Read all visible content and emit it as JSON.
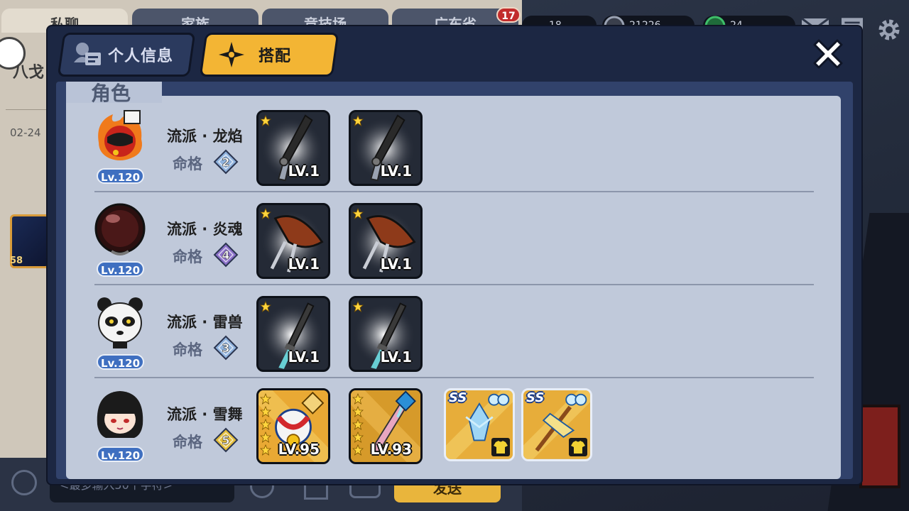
{
  "background": {
    "tabs": [
      "私聊",
      "家族",
      "竞技场",
      "广东省"
    ],
    "tab_badge": "17",
    "chat_title": "八戈",
    "chat_date": "02-24",
    "chat_thumb_level": "58",
    "chat_input_placeholder": "<最多输入50个字符>",
    "send_label": "发送",
    "stats": [
      "18",
      "21226",
      "24"
    ]
  },
  "dialog": {
    "tab_info_label": "个人信息",
    "tab_match_label": "搭配",
    "section_title": "角色",
    "fate_label": "命格",
    "rows": [
      {
        "level": "Lv.120",
        "school": "流派 · 龙焰",
        "fate": "2",
        "fate_color": "#8fb2dd",
        "avatar": "fire-ninja-avatar",
        "equips": [
          {
            "kind": "dark-blade",
            "level": "LV.1",
            "stars": 1
          },
          {
            "kind": "dark-blade",
            "level": "LV.1",
            "stars": 1
          }
        ]
      },
      {
        "level": "Lv.120",
        "school": "流派 · 炎魂",
        "fate": "4",
        "fate_color": "#8a6fc8",
        "avatar": "dark-orb-avatar",
        "equips": [
          {
            "kind": "brown-shard",
            "level": "LV.1",
            "stars": 1
          },
          {
            "kind": "brown-shard",
            "level": "LV.1",
            "stars": 1
          }
        ]
      },
      {
        "level": "Lv.120",
        "school": "流派 · 雷兽",
        "fate": "3",
        "fate_color": "#8fb2dd",
        "avatar": "panda-avatar",
        "equips": [
          {
            "kind": "katana",
            "level": "LV.1",
            "stars": 1
          },
          {
            "kind": "katana",
            "level": "LV.1",
            "stars": 1
          }
        ]
      },
      {
        "level": "Lv.120",
        "school": "流派 · 雪舞",
        "fate": "5",
        "fate_color": "#e3bd3a",
        "avatar": "black-hair-girl-avatar",
        "equips": [
          {
            "kind": "gold-charm",
            "level": "LV.95",
            "stars": 5
          },
          {
            "kind": "pink-sword",
            "level": "LV.93",
            "stars": 5
          }
        ],
        "cards": [
          {
            "label": "SS",
            "kind": "ice-crystal"
          },
          {
            "label": "SS",
            "kind": "staff"
          }
        ]
      }
    ]
  }
}
